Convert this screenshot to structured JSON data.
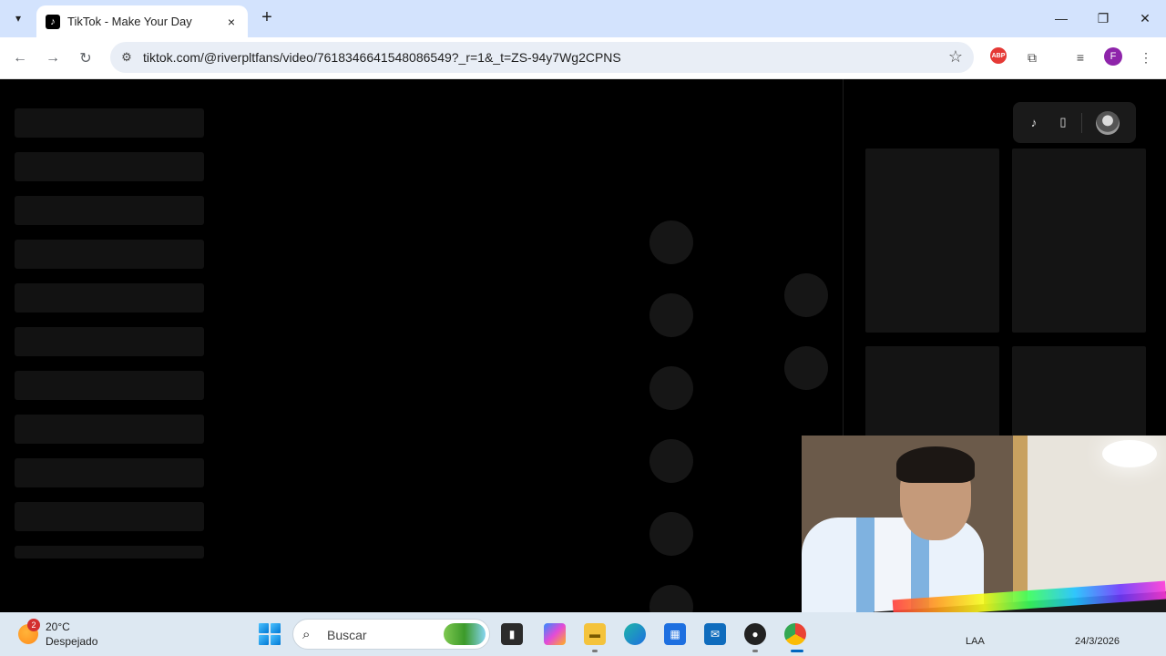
{
  "browser": {
    "tab": {
      "title": "TikTok - Make Your Day",
      "favicon": "tiktok-icon",
      "close": "×"
    },
    "new_tab": "+",
    "window_controls": {
      "minimize": "—",
      "maximize": "❐",
      "close": "✕"
    },
    "url": "tiktok.com/@riverpltfans/video/7618346641548086549?_r=1&_t=ZS-94y7Wg2CPNS",
    "profile_initial": "F",
    "extensions": [
      "adblock-icon",
      "puzzle-icon",
      "media-control-icon"
    ],
    "adblock_label": "ABP"
  },
  "page": {
    "state": "loading-skeleton",
    "left_skeleton_bars": 11,
    "action_circles": 6,
    "right_thumbnails": 4,
    "top_controls": [
      "tiktok-icon",
      "phone-icon",
      "avatar"
    ]
  },
  "taskbar": {
    "weather": {
      "temp": "20°C",
      "condition": "Despejado",
      "badge": "2"
    },
    "search_placeholder": "Buscar",
    "tray_text_1": "LAA",
    "tray_date": "24/3/2026",
    "apps": [
      "start-icon",
      "file-manager-icon",
      "copilot-icon",
      "file-explorer-icon",
      "edge-icon",
      "store-icon",
      "outlook-icon",
      "obs-icon",
      "chrome-icon"
    ]
  },
  "colors": {
    "tabbar": "#d3e3fd",
    "page_bg": "#000000",
    "skeleton": "#121212",
    "taskbar": "#dde8f2"
  }
}
